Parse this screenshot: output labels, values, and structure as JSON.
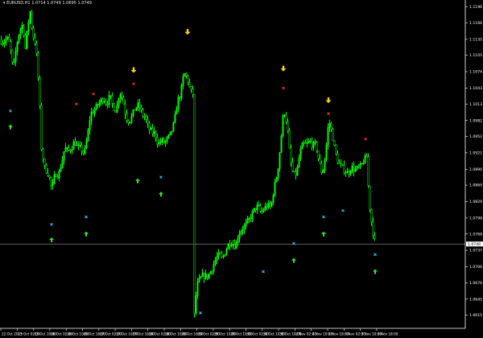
{
  "header": {
    "title": "▾ EURUSD,H1 1.0714 1.0749 1.0695 1.0749"
  },
  "colors": {
    "background": "#000000",
    "candle": "#00ff00",
    "axis": "#ffffff",
    "axis_text": "#ffffff",
    "price_line": "#7f7f7f",
    "price_tag_bg": "#ffffff",
    "price_tag_text": "#000000",
    "buy_arrow": "#2ee62e",
    "sell_arrow": "#ffd700",
    "buy_cross": "#38c8ff",
    "sell_cross": "#ff3030"
  },
  "icons": {
    "buy_signal": "up-arrow-icon",
    "sell_signal": "down-arrow-icon",
    "cross_marker": "x-cross-icon"
  },
  "chart_data": {
    "type": "candlestick",
    "symbol": "EURUSD",
    "timeframe": "H1",
    "ylim": [
      1.059,
      1.12
    ],
    "price_ticks": [
      "1.1196",
      "1.1166",
      "1.1135",
      "1.1105",
      "1.1074",
      "1.1043",
      "1.1013",
      "1.0982",
      "1.0952",
      "1.0921",
      "1.0890",
      "1.0860",
      "1.0829",
      "1.0798",
      "1.0768",
      "1.0737",
      "1.0706",
      "1.0676",
      "1.0645",
      "1.0615"
    ],
    "time_ticks": [
      "22 Oct 2015",
      "23 Oct 02:00",
      "23 Oct 10:00",
      "26 Oct 02:00",
      "26 Oct 10:00",
      "26 Oct 18:00",
      "27 Oct 02:00",
      "27 Oct 10:00",
      "27 Oct 18:00",
      "28 Oct 02:00",
      "28 Oct 10:00",
      "28 Oct 18:00",
      "29 Oct 02:00",
      "29 Oct 10:00",
      "29 Oct 18:00",
      "30 Oct 02:00",
      "30 Oct 10:00",
      "30 Oct 18:00",
      "2 Nov 02:00",
      "2 Nov 10:00",
      "2 Nov 18:00",
      "3 Nov 02:00",
      "3 Nov 10:00",
      "3 Nov 18:00"
    ],
    "current_price": 1.0749,
    "current_price_label": "1.0749",
    "grid": false,
    "close_path": [
      [
        0,
        1.1134
      ],
      [
        4,
        1.1128
      ],
      [
        8,
        1.1139
      ],
      [
        12,
        1.1125
      ],
      [
        16,
        1.1076
      ],
      [
        20,
        1.1123
      ],
      [
        24,
        1.1153
      ],
      [
        28,
        1.1163
      ],
      [
        31,
        1.1118
      ],
      [
        34,
        1.116
      ],
      [
        37,
        1.1187
      ],
      [
        40,
        1.1145
      ],
      [
        44,
        1.1125
      ],
      [
        48,
        1.1042
      ],
      [
        51,
        1.093
      ],
      [
        55,
        1.0893
      ],
      [
        60,
        1.088
      ],
      [
        64,
        1.0851
      ],
      [
        68,
        1.0883
      ],
      [
        72,
        1.0878
      ],
      [
        76,
        1.0901
      ],
      [
        80,
        1.0931
      ],
      [
        84,
        1.0924
      ],
      [
        88,
        1.0929
      ],
      [
        92,
        1.0943
      ],
      [
        96,
        1.093
      ],
      [
        100,
        1.093
      ],
      [
        104,
        1.0918
      ],
      [
        108,
        1.095
      ],
      [
        112,
        1.0995
      ],
      [
        116,
        1.1
      ],
      [
        120,
        1.1009
      ],
      [
        124,
        1.1018
      ],
      [
        128,
        1.1024
      ],
      [
        132,
        1.1013
      ],
      [
        136,
        1.1028
      ],
      [
        140,
        1.1008
      ],
      [
        144,
        1.1
      ],
      [
        148,
        1.1037
      ],
      [
        152,
        1.1023
      ],
      [
        156,
        1.0988
      ],
      [
        160,
        1.098
      ],
      [
        164,
        1.0993
      ],
      [
        168,
        1.1007
      ],
      [
        172,
        1.1011
      ],
      [
        176,
        1.0994
      ],
      [
        180,
        1.0987
      ],
      [
        184,
        1.0967
      ],
      [
        188,
        1.096
      ],
      [
        192,
        1.0958
      ],
      [
        196,
        1.0937
      ],
      [
        200,
        1.0944
      ],
      [
        204,
        1.094
      ],
      [
        208,
        1.0948
      ],
      [
        212,
        1.0958
      ],
      [
        216,
        1.0979
      ],
      [
        220,
        1.1018
      ],
      [
        224,
        1.1032
      ],
      [
        228,
        1.1071
      ],
      [
        232,
        1.1063
      ],
      [
        236,
        1.1038
      ],
      [
        240,
        1.103
      ],
      [
        241,
        1.0615
      ],
      [
        244,
        1.067
      ],
      [
        248,
        1.0683
      ],
      [
        252,
        1.069
      ],
      [
        256,
        1.0687
      ],
      [
        260,
        1.0693
      ],
      [
        264,
        1.0707
      ],
      [
        268,
        1.0722
      ],
      [
        272,
        1.0729
      ],
      [
        276,
        1.0721
      ],
      [
        280,
        1.0738
      ],
      [
        284,
        1.0751
      ],
      [
        288,
        1.0752
      ],
      [
        292,
        1.0744
      ],
      [
        296,
        1.0769
      ],
      [
        300,
        1.0777
      ],
      [
        304,
        1.0783
      ],
      [
        308,
        1.0793
      ],
      [
        312,
        1.0803
      ],
      [
        316,
        1.0816
      ],
      [
        320,
        1.082
      ],
      [
        324,
        1.0807
      ],
      [
        328,
        1.0817
      ],
      [
        332,
        1.0822
      ],
      [
        336,
        1.0818
      ],
      [
        340,
        1.0855
      ],
      [
        344,
        1.0881
      ],
      [
        348,
        1.0937
      ],
      [
        352,
        1.1004
      ],
      [
        356,
        1.0976
      ],
      [
        360,
        1.0909
      ],
      [
        364,
        1.0878
      ],
      [
        368,
        1.0882
      ],
      [
        372,
        1.092
      ],
      [
        376,
        1.0938
      ],
      [
        380,
        1.0936
      ],
      [
        384,
        1.0943
      ],
      [
        388,
        1.0935
      ],
      [
        392,
        1.0937
      ],
      [
        396,
        1.0903
      ],
      [
        400,
        1.088
      ],
      [
        404,
        1.092
      ],
      [
        408,
        1.0983
      ],
      [
        412,
        1.0958
      ],
      [
        416,
        1.0922
      ],
      [
        420,
        1.0901
      ],
      [
        424,
        1.0894
      ],
      [
        428,
        1.0887
      ],
      [
        432,
        1.0882
      ],
      [
        436,
        1.0895
      ],
      [
        440,
        1.0888
      ],
      [
        444,
        1.0892
      ],
      [
        448,
        1.0896
      ],
      [
        452,
        1.0908
      ],
      [
        455,
        1.0913
      ],
      [
        458,
        1.0831
      ],
      [
        462,
        1.0778
      ],
      [
        466,
        1.0749
      ]
    ],
    "signals": [
      {
        "kind": "buy_arrow",
        "x": 13,
        "price": 1.097
      },
      {
        "kind": "buy_cross",
        "x": 13,
        "price": 1.1
      },
      {
        "kind": "buy_arrow",
        "x": 64,
        "price": 1.0757
      },
      {
        "kind": "buy_cross",
        "x": 64,
        "price": 1.0786
      },
      {
        "kind": "buy_arrow",
        "x": 107,
        "price": 1.0768
      },
      {
        "kind": "buy_cross",
        "x": 107,
        "price": 1.08
      },
      {
        "kind": "buy_arrow",
        "x": 171,
        "price": 1.0868
      },
      {
        "kind": "buy_arrow",
        "x": 200,
        "price": 1.0843
      },
      {
        "kind": "buy_cross",
        "x": 200,
        "price": 1.0875
      },
      {
        "kind": "buy_cross",
        "x": 249,
        "price": 1.0619
      },
      {
        "kind": "buy_cross",
        "x": 327,
        "price": 1.0697
      },
      {
        "kind": "buy_arrow",
        "x": 365,
        "price": 1.0718
      },
      {
        "kind": "buy_cross",
        "x": 365,
        "price": 1.075
      },
      {
        "kind": "buy_arrow",
        "x": 402,
        "price": 1.0768
      },
      {
        "kind": "buy_cross",
        "x": 402,
        "price": 1.08
      },
      {
        "kind": "buy_cross",
        "x": 426,
        "price": 1.0812
      },
      {
        "kind": "buy_arrow",
        "x": 466,
        "price": 1.0697
      },
      {
        "kind": "buy_cross",
        "x": 466,
        "price": 1.0729
      },
      {
        "kind": "sell_arrow",
        "x": 166,
        "price": 1.1077
      },
      {
        "kind": "sell_cross",
        "x": 166,
        "price": 1.1051
      },
      {
        "kind": "sell_cross",
        "x": 95,
        "price": 1.1013
      },
      {
        "kind": "sell_cross",
        "x": 116,
        "price": 1.1032
      },
      {
        "kind": "sell_arrow",
        "x": 233,
        "price": 1.1149
      },
      {
        "kind": "sell_arrow",
        "x": 352,
        "price": 1.108
      },
      {
        "kind": "sell_cross",
        "x": 352,
        "price": 1.1043
      },
      {
        "kind": "sell_arrow",
        "x": 408,
        "price": 1.102
      },
      {
        "kind": "sell_cross",
        "x": 408,
        "price": 1.0995
      },
      {
        "kind": "sell_cross",
        "x": 454,
        "price": 1.0947
      }
    ]
  }
}
